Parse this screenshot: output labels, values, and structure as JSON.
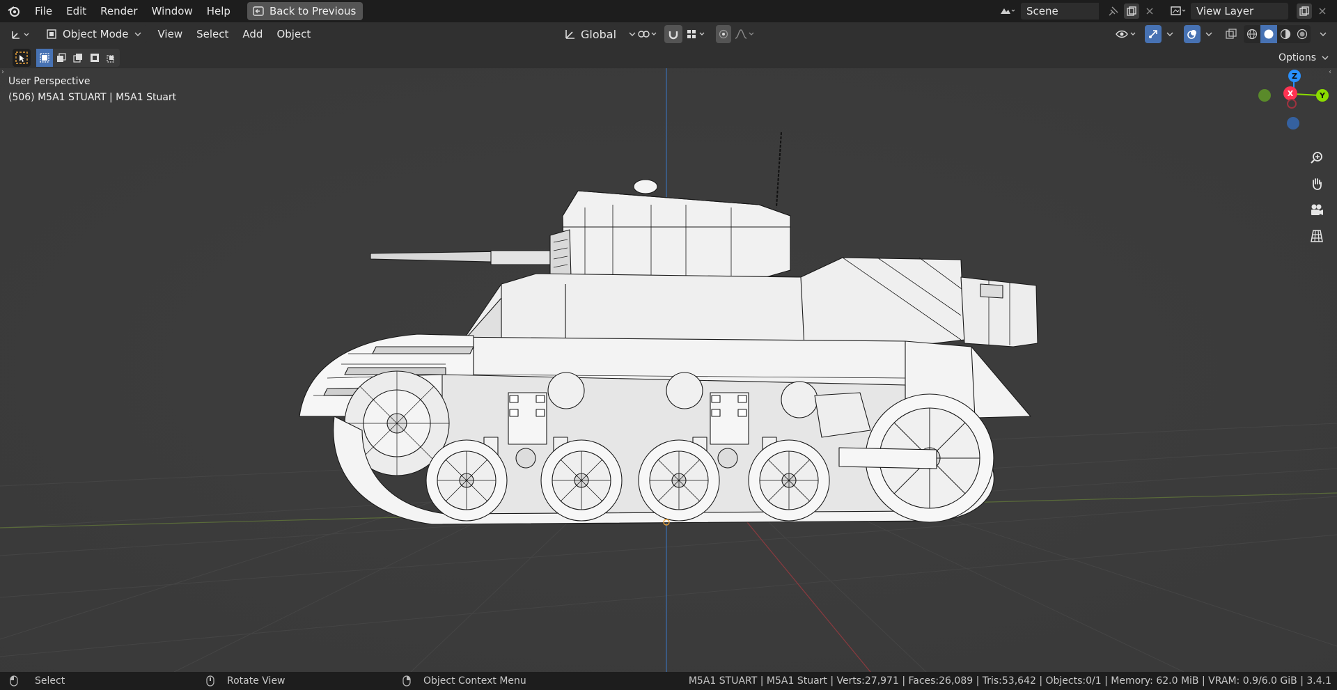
{
  "menu": {
    "file": "File",
    "edit": "Edit",
    "render": "Render",
    "window": "Window",
    "help": "Help",
    "back": "Back to Previous"
  },
  "scene": {
    "name": "Scene",
    "view_layer": "View Layer"
  },
  "header": {
    "mode": "Object Mode",
    "view": "View",
    "select": "Select",
    "add": "Add",
    "object": "Object",
    "orientation": "Global",
    "options": "Options"
  },
  "viewport": {
    "perspective": "User Perspective",
    "object_info": "(506) M5A1 STUART | M5A1 Stuart"
  },
  "gizmo": {
    "z": "Z",
    "x": "X",
    "y": "Y"
  },
  "status": {
    "select": "Select",
    "rotate": "Rotate View",
    "context": "Object Context Menu",
    "stats": "M5A1 STUART | M5A1 Stuart | Verts:27,971 | Faces:26,089 | Tris:53,642 | Objects:0/1 | Memory: 62.0 MiB | VRAM: 0.9/6.0 GiB | 3.4.1"
  },
  "colors": {
    "topbar": "#1d1d1d",
    "header": "#303030",
    "viewport": "#3c3c3c",
    "accent_blue": "#4772b3",
    "axis_x": "#ff3352",
    "axis_y": "#8bdc00",
    "axis_z": "#2890ff"
  }
}
